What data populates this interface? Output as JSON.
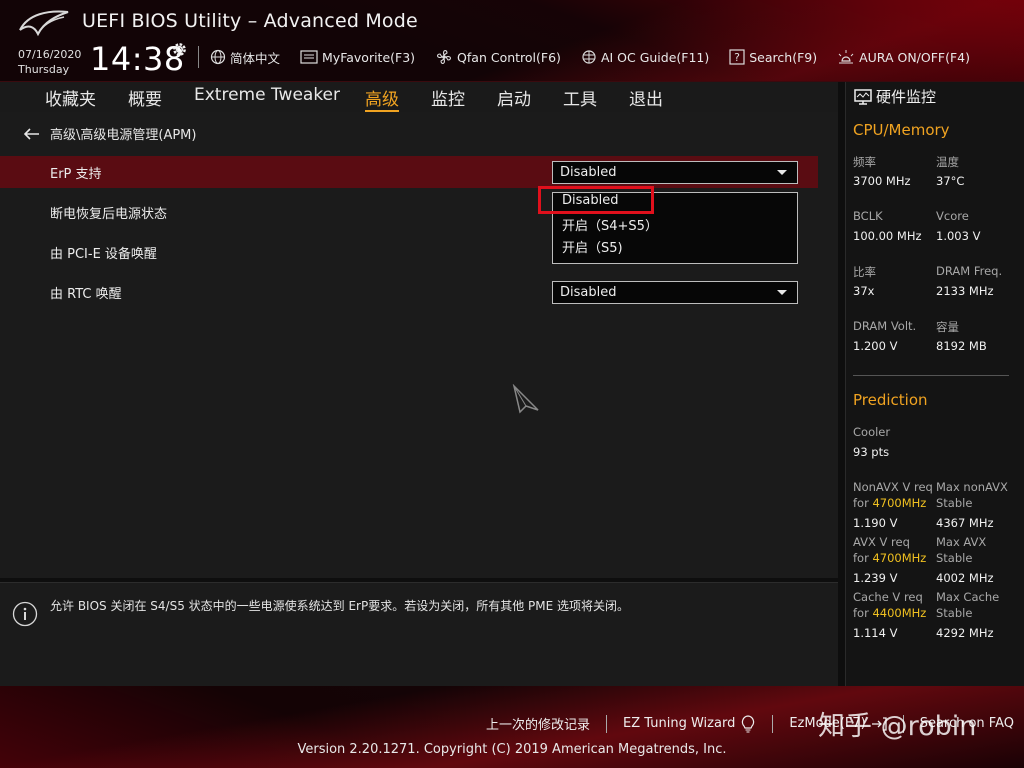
{
  "header": {
    "app_title": "UEFI BIOS Utility – Advanced Mode",
    "date": "07/16/2020",
    "day": "Thursday",
    "time": "14:38",
    "tools": [
      {
        "label": "简体中文",
        "icon": "globe-icon"
      },
      {
        "label": "MyFavorite(F3)",
        "icon": "favorite-icon"
      },
      {
        "label": "Qfan Control(F6)",
        "icon": "fan-icon"
      },
      {
        "label": "AI OC Guide(F11)",
        "icon": "ai-chip-icon"
      },
      {
        "label": "Search(F9)",
        "icon": "help-search-icon"
      },
      {
        "label": "AURA ON/OFF(F4)",
        "icon": "aura-light-icon"
      }
    ]
  },
  "tabs": [
    {
      "label": "收藏夹",
      "active": false
    },
    {
      "label": "概要",
      "active": false
    },
    {
      "label": "Extreme Tweaker",
      "active": false
    },
    {
      "label": "高级",
      "active": true
    },
    {
      "label": "监控",
      "active": false
    },
    {
      "label": "启动",
      "active": false
    },
    {
      "label": "工具",
      "active": false
    },
    {
      "label": "退出",
      "active": false
    }
  ],
  "breadcrumb": "高级\\高级电源管理(APM)",
  "settings": [
    {
      "label": "ErP 支持",
      "value": "Disabled",
      "selected": true
    },
    {
      "label": "断电恢复后电源状态",
      "value": ""
    },
    {
      "label": "由 PCI-E 设备唤醒",
      "value": ""
    },
    {
      "label": "由 RTC 唤醒",
      "value": "Disabled"
    }
  ],
  "dropdown_options": [
    "Disabled",
    "开启（S4+S5）",
    "开启（S5)"
  ],
  "help_text": "允许 BIOS 关闭在 S4/S5 状态中的一些电源使系统达到 ErP要求。若设为关闭，所有其他 PME 选项将关闭。",
  "hw_monitor": {
    "title": "硬件监控",
    "cpu_section": "CPU/Memory",
    "cpu_items": [
      {
        "label": "频率",
        "value": "3700 MHz"
      },
      {
        "label": "温度",
        "value": "37°C"
      },
      {
        "label": "BCLK",
        "value": "100.00 MHz"
      },
      {
        "label": "Vcore",
        "value": "1.003 V"
      },
      {
        "label": "比率",
        "value": "37x"
      },
      {
        "label": "DRAM Freq.",
        "value": "2133 MHz"
      },
      {
        "label": "DRAM Volt.",
        "value": "1.200 V"
      },
      {
        "label": "容量",
        "value": "8192 MB"
      }
    ],
    "prediction_section": "Prediction",
    "cooler_label": "Cooler",
    "cooler_value": "93 pts",
    "prediction_items": [
      {
        "label_a": "NonAVX V req",
        "label_b": "for",
        "freq": "4700MHz",
        "value": "1.190 V",
        "right_label_a": "Max nonAVX",
        "right_label_b": "Stable",
        "right_value": "4367 MHz"
      },
      {
        "label_a": "AVX V req",
        "label_b": "for",
        "freq": "4700MHz",
        "value": "1.239 V",
        "right_label_a": "Max AVX",
        "right_label_b": "Stable",
        "right_value": "4002 MHz"
      },
      {
        "label_a": "Cache V req",
        "label_b": "for",
        "freq": "4400MHz",
        "value": "1.114 V",
        "right_label_a": "Max Cache",
        "right_label_b": "Stable",
        "right_value": "4292 MHz"
      }
    ]
  },
  "footer": {
    "links": [
      "上一次的修改记录",
      "EZ Tuning Wizard",
      "EzMode(F7)",
      "Search on FAQ"
    ],
    "version": "Version 2.20.1271. Copyright (C) 2019 American Megatrends, Inc.",
    "watermark": "知乎 @robin"
  },
  "colors": {
    "accent": "#f0a321",
    "selected_row": "#5a0c12",
    "highlight": "#e0101c",
    "frequency": "#f0c020"
  }
}
